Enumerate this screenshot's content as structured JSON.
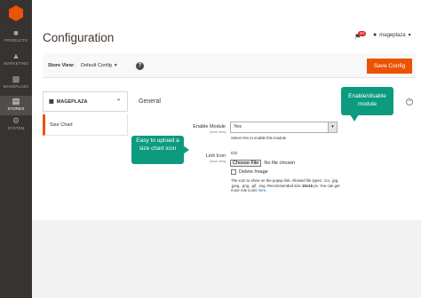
{
  "sidebar": {
    "items": [
      {
        "label": "PRODUCTS",
        "icon": "cube-icon"
      },
      {
        "label": "MARKETING",
        "icon": "megaphone-icon"
      },
      {
        "label": "MAGEPLAZA",
        "icon": "mageplaza-icon"
      },
      {
        "label": "STORES",
        "icon": "store-icon",
        "active": true
      },
      {
        "label": "SYSTEM",
        "icon": "gear-icon"
      }
    ]
  },
  "header": {
    "title": "Configuration",
    "notification_count": "34",
    "user_name": "mageplaza"
  },
  "store_bar": {
    "label": "Store View:",
    "selected": "Default Config",
    "help": "?",
    "save_label": "Save Config"
  },
  "tabs": {
    "group": "MAGEPLAZA",
    "item": "Size Chart"
  },
  "section": {
    "title": "General",
    "enable_label": "Enable Module",
    "enable_scope": "[store view]",
    "enable_value": "Yes",
    "enable_note": "Select Yes to enable this module",
    "icon_label": "Link Icon",
    "icon_scope": "[store view]",
    "choose_file": "Choose File",
    "no_file": "No file chosen",
    "delete_label": "Delete Image",
    "icon_note_1": "The icon to show on the popup link. Allowed file types: .ico, .jpg, .jpeg, .png, .gif, .svg. Recommended size",
    "icon_note_size": "16x16",
    "icon_note_2": "px. You can get more rule icons",
    "icon_note_link": "here",
    "icon_note_end": "."
  },
  "callouts": {
    "module": "Enable/disable module",
    "size_chart": "Easy to upload a size chart icon"
  },
  "colors": {
    "accent": "#eb5202",
    "sidebar": "#373330",
    "callout": "#0c9b7f"
  }
}
